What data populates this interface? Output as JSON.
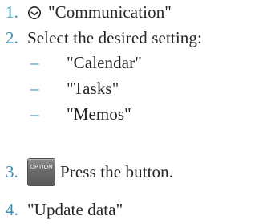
{
  "steps": [
    {
      "number": "1.",
      "icon": "communication-arrow-icon",
      "text": "\"Communication\""
    },
    {
      "number": "2.",
      "text": "Select the desired setting:"
    },
    {
      "number": "3.",
      "button_label": "OPTION",
      "text": "Press the button."
    },
    {
      "number": "4.",
      "text": "\"Update data\""
    }
  ],
  "sub_options": [
    {
      "dash": "–",
      "text": "\"Calendar\""
    },
    {
      "dash": "–",
      "text": "\"Tasks\""
    },
    {
      "dash": "–",
      "text": "\"Memos\""
    }
  ],
  "colors": {
    "number": "#3a8fb2",
    "text": "#262626",
    "button": "#6a6a6a"
  }
}
